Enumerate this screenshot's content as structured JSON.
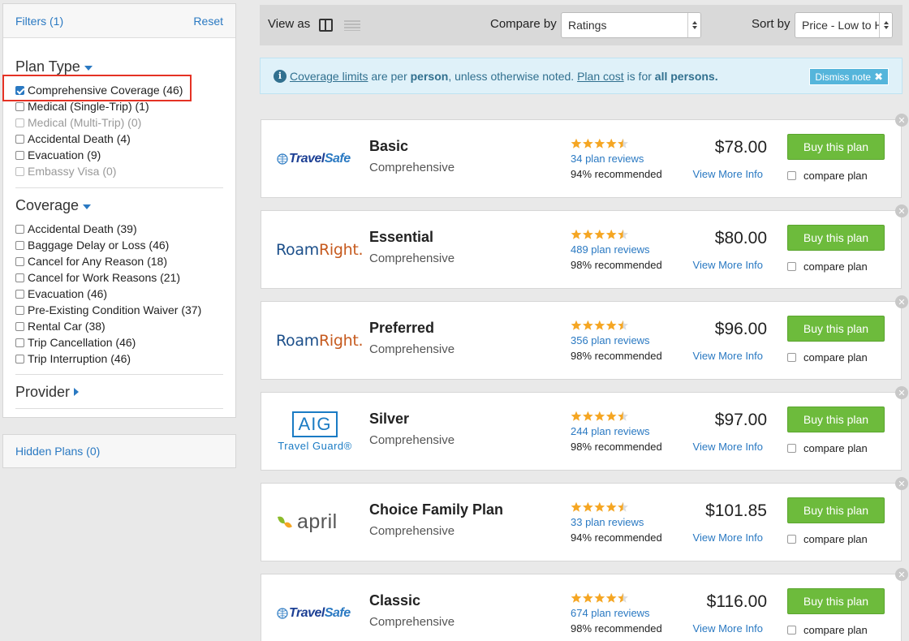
{
  "sidebar": {
    "filters_label": "Filters (1)",
    "reset_label": "Reset",
    "plan_type": {
      "title": "Plan Type",
      "options": [
        {
          "label": "Comprehensive Coverage (46)",
          "checked": true,
          "disabled": false
        },
        {
          "label": "Medical (Single-Trip) (1)",
          "checked": false,
          "disabled": false
        },
        {
          "label": "Medical (Multi-Trip) (0)",
          "checked": false,
          "disabled": true
        },
        {
          "label": "Accidental Death (4)",
          "checked": false,
          "disabled": false
        },
        {
          "label": "Evacuation (9)",
          "checked": false,
          "disabled": false
        },
        {
          "label": "Embassy Visa (0)",
          "checked": false,
          "disabled": true
        }
      ]
    },
    "coverage": {
      "title": "Coverage",
      "options": [
        {
          "label": "Accidental Death (39)"
        },
        {
          "label": "Baggage Delay or Loss (46)"
        },
        {
          "label": "Cancel for Any Reason (18)"
        },
        {
          "label": "Cancel for Work Reasons (21)"
        },
        {
          "label": "Evacuation (46)"
        },
        {
          "label": "Pre-Existing Condition Waiver (37)"
        },
        {
          "label": "Rental Car (38)"
        },
        {
          "label": "Trip Cancellation (46)"
        },
        {
          "label": "Trip Interruption (46)"
        }
      ]
    },
    "provider_title": "Provider",
    "hidden_plans_label": "Hidden Plans (0)"
  },
  "toolbar": {
    "view_as_label": "View as",
    "compare_by_label": "Compare by",
    "compare_by_value": "Ratings",
    "sort_by_label": "Sort by",
    "sort_by_value": "Price - Low to High"
  },
  "note": {
    "link1": "Coverage limits",
    "text1": " are per ",
    "bold1": "person",
    "text2": ", unless otherwise noted. ",
    "link2": "Plan cost",
    "text3": " is for ",
    "bold2": "all persons.",
    "dismiss_label": "Dismiss note"
  },
  "plans": [
    {
      "provider": "TravelSafe",
      "name": "Basic",
      "type": "Comprehensive",
      "reviews": "34 plan reviews",
      "recommended": "94% recommended",
      "price": "$78.00",
      "rating": 4.5
    },
    {
      "provider": "RoamRight",
      "name": "Essential",
      "type": "Comprehensive",
      "reviews": "489 plan reviews",
      "recommended": "98% recommended",
      "price": "$80.00",
      "rating": 4.5
    },
    {
      "provider": "RoamRight",
      "name": "Preferred",
      "type": "Comprehensive",
      "reviews": "356 plan reviews",
      "recommended": "98% recommended",
      "price": "$96.00",
      "rating": 4.5
    },
    {
      "provider": "AIG Travel Guard",
      "name": "Silver",
      "type": "Comprehensive",
      "reviews": "244 plan reviews",
      "recommended": "98% recommended",
      "price": "$97.00",
      "rating": 4.5
    },
    {
      "provider": "april",
      "name": "Choice Family Plan",
      "type": "Comprehensive",
      "reviews": "33 plan reviews",
      "recommended": "94% recommended",
      "price": "$101.85",
      "rating": 4.5
    },
    {
      "provider": "TravelSafe",
      "name": "Classic",
      "type": "Comprehensive",
      "reviews": "674 plan reviews",
      "recommended": "98% recommended",
      "price": "$116.00",
      "rating": 4.5
    }
  ],
  "common": {
    "view_more_label": "View More Info",
    "buy_label": "Buy this plan",
    "compare_label": "compare plan"
  },
  "logos": {
    "travelsafe_a": "Travel",
    "travelsafe_b": "Safe",
    "roamright_a": "Roam",
    "roamright_b": "Right.",
    "aig_top": "AIG",
    "aig_bottom": "Travel Guard®",
    "april": "april"
  },
  "colors": {
    "accent_blue": "#2a79c2",
    "buy_green": "#6dbb3c",
    "star_orange": "#f5a623",
    "highlight_red": "#e53224"
  }
}
